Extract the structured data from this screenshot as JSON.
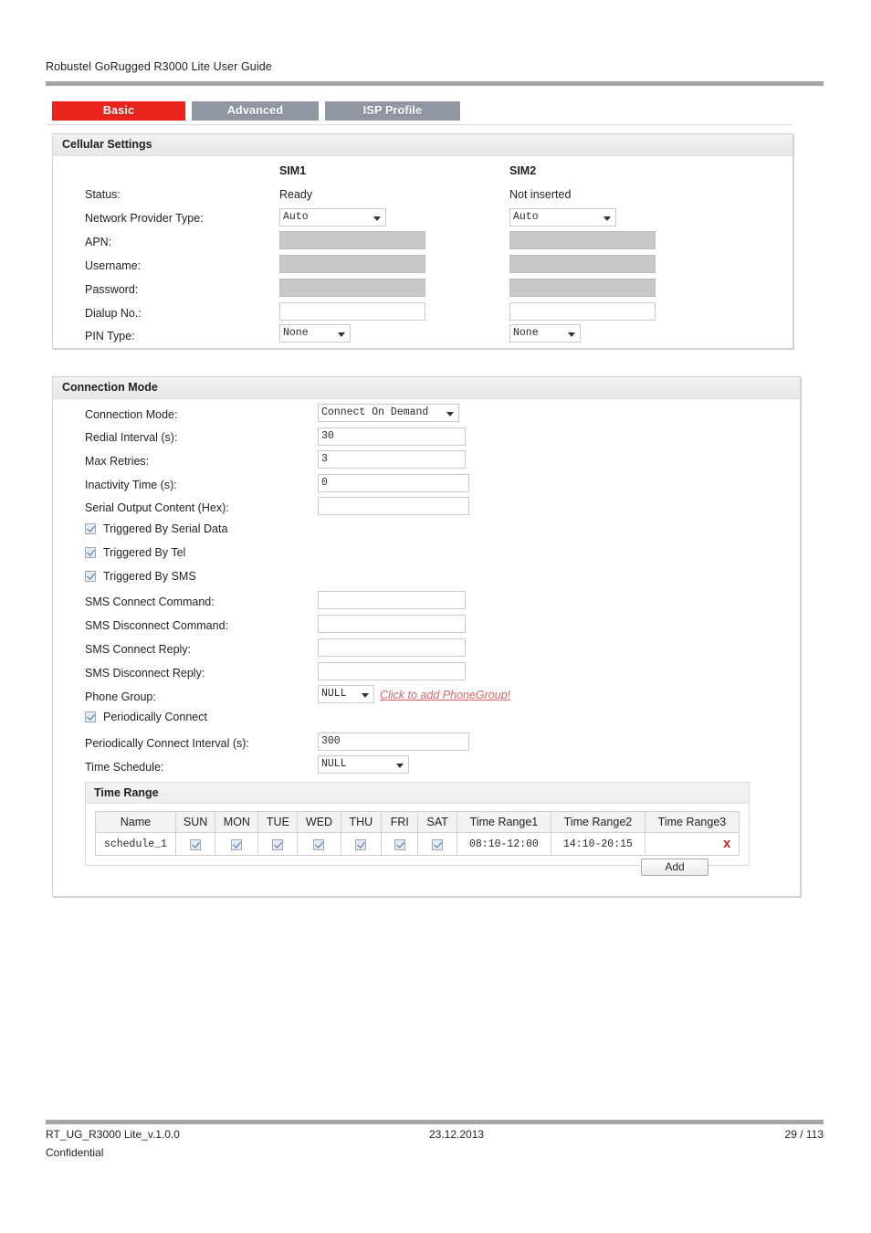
{
  "document": {
    "header_title": "Robustel GoRugged R3000 Lite User Guide",
    "footer": {
      "file_id": "RT_UG_R3000 Lite_v.1.0.0",
      "confidential": "Confidential",
      "date": "23.12.2013",
      "page": "29 / 113"
    }
  },
  "colors": {
    "tab_active": "#e8241c",
    "tab_idle": "#9196a3",
    "link_red": "#e06666",
    "delete_red": "#cc2222"
  },
  "tabs": [
    {
      "label": "Basic",
      "active": true
    },
    {
      "label": "Advanced",
      "active": false
    },
    {
      "label": "ISP Profile",
      "active": false
    }
  ],
  "cellular_settings": {
    "title": "Cellular Settings",
    "column_headers": {
      "sim1": "SIM1",
      "sim2": "SIM2"
    },
    "labels": {
      "status": "Status:",
      "network_provider_type": "Network Provider Type:",
      "apn": "APN:",
      "username": "Username:",
      "password": "Password:",
      "dialup_no": "Dialup No.:",
      "pin_type": "PIN Type:"
    },
    "sim1": {
      "status": "Ready",
      "network_provider_type": "Auto",
      "apn": "",
      "username": "",
      "password": "",
      "dialup_no": "",
      "pin_type": "None"
    },
    "sim2": {
      "status": "Not inserted",
      "network_provider_type": "Auto",
      "apn": "",
      "username": "",
      "password": "",
      "dialup_no": "",
      "pin_type": "None"
    }
  },
  "connection_mode": {
    "title": "Connection Mode",
    "labels": {
      "connection_mode": "Connection Mode:",
      "redial_interval": "Redial Interval (s):",
      "max_retries": "Max Retries:",
      "inactivity_time": "Inactivity Time (s):",
      "serial_output_content": "Serial Output Content (Hex):",
      "triggered_by_serial_data": "Triggered By Serial Data",
      "triggered_by_tel": "Triggered By Tel",
      "triggered_by_sms": "Triggered By SMS",
      "sms_connect_command": "SMS Connect Command:",
      "sms_disconnect_command": "SMS Disconnect Command:",
      "sms_connect_reply": "SMS Connect Reply:",
      "sms_disconnect_reply": "SMS Disconnect Reply:",
      "phone_group": "Phone Group:",
      "periodically_connect": "Periodically Connect",
      "periodically_connect_interval": "Periodically Connect Interval (s):",
      "time_schedule": "Time Schedule:"
    },
    "values": {
      "connection_mode": "Connect On Demand",
      "redial_interval": "30",
      "max_retries": "3",
      "inactivity_time": "0",
      "serial_output_content": "",
      "sms_connect_command": "",
      "sms_disconnect_command": "",
      "sms_connect_reply": "",
      "sms_disconnect_reply": "",
      "phone_group": "NULL",
      "periodically_connect_interval": "300",
      "time_schedule": "NULL"
    },
    "checkboxes": {
      "triggered_by_serial_data": true,
      "triggered_by_tel": true,
      "triggered_by_sms": true,
      "periodically_connect": true
    },
    "phone_group_link": "Click to add PhoneGroup!"
  },
  "time_range": {
    "title": "Time Range",
    "headers": [
      "Name",
      "SUN",
      "MON",
      "TUE",
      "WED",
      "THU",
      "FRI",
      "SAT",
      "Time Range1",
      "Time Range2",
      "Time Range3"
    ],
    "rows": [
      {
        "name": "schedule_1",
        "sun": true,
        "mon": true,
        "tue": true,
        "wed": true,
        "thu": true,
        "fri": true,
        "sat": true,
        "range1": "08:10-12:00",
        "range2": "14:10-20:15",
        "range3": "",
        "delete_label": "x"
      }
    ],
    "add_label": "Add"
  }
}
